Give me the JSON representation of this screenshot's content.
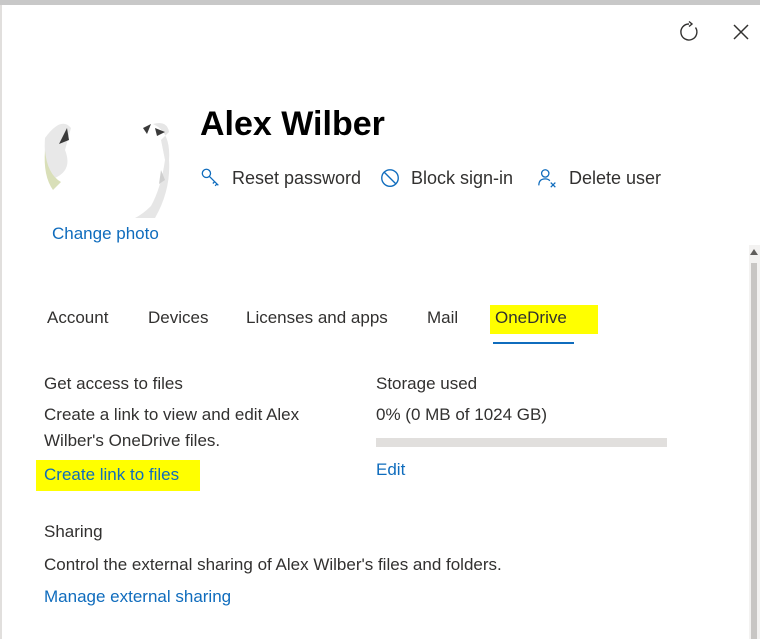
{
  "header": {
    "user_name": "Alex Wilber",
    "change_photo_label": "Change photo",
    "refresh_icon": "refresh-icon",
    "close_icon": "close-icon"
  },
  "actions": [
    {
      "label": "Reset password",
      "icon": "key-icon"
    },
    {
      "label": "Block sign-in",
      "icon": "block-icon"
    },
    {
      "label": "Delete user",
      "icon": "delete-user-icon"
    }
  ],
  "tabs": [
    {
      "label": "Account",
      "selected": false
    },
    {
      "label": "Devices",
      "selected": false
    },
    {
      "label": "Licenses and apps",
      "selected": false
    },
    {
      "label": "Mail",
      "selected": false
    },
    {
      "label": "OneDrive",
      "selected": true
    }
  ],
  "files": {
    "title": "Get access to files",
    "description_line1": "Create a link to view and edit Alex",
    "description_line2": "Wilber's OneDrive files.",
    "link_label": "Create link to files"
  },
  "storage": {
    "title": "Storage used",
    "value_text": "0% (0 MB of 1024 GB)",
    "used_fraction": 0,
    "edit_label": "Edit"
  },
  "sharing": {
    "title": "Sharing",
    "description": "Control the external sharing of Alex Wilber's files and folders.",
    "link_label": "Manage external sharing"
  },
  "colors": {
    "accent": "#0f6cbd",
    "highlight": "#ffff00",
    "text": "#323130"
  }
}
